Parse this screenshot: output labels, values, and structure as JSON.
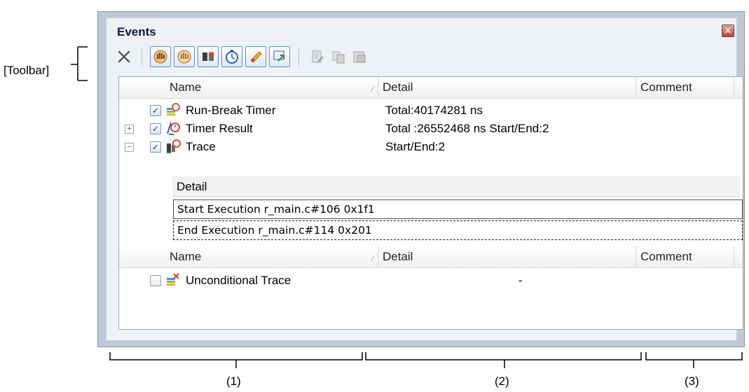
{
  "annotations": {
    "toolbar_label": "[Toolbar]",
    "col1": "(1)",
    "col2": "(2)",
    "col3": "(3)"
  },
  "window": {
    "title": "Events",
    "close_glyph": "✕"
  },
  "toolbar": {
    "buttons": [
      {
        "icon": "delete-icon"
      },
      {
        "icon": "hardware-break-icon"
      },
      {
        "icon": "software-break-icon"
      },
      {
        "icon": "trace-icon"
      },
      {
        "icon": "timer-icon"
      },
      {
        "icon": "point-trace-icon"
      },
      {
        "icon": "jump-source-icon"
      },
      {
        "icon": "edit-comment-icon"
      },
      {
        "icon": "copy-icon"
      },
      {
        "icon": "paste-icon"
      }
    ]
  },
  "table": {
    "header": {
      "name": "Name",
      "detail": "Detail",
      "comment": "Comment"
    },
    "rows": [
      {
        "name": "Run-Break Timer",
        "detail": "Total:40174281 ns",
        "checked": true,
        "expander": ""
      },
      {
        "name": "Timer Result",
        "detail": "Total :26552468 ns  Start/End:2",
        "checked": true,
        "expander": "+"
      },
      {
        "name": "Trace",
        "detail": "Start/End:2",
        "checked": true,
        "expander": "−"
      }
    ],
    "sub_table": {
      "header": "Detail",
      "rows": [
        "Start Execution r_main.c#106 0x1f1",
        "End Execution r_main.c#114 0x201"
      ]
    },
    "header2": {
      "name": "Name",
      "detail": "Detail",
      "comment": "Comment"
    },
    "rows2": [
      {
        "name": "Unconditional Trace",
        "detail": "-",
        "checked": false
      }
    ]
  },
  "colors": {
    "window_frame": "#bfc9d6",
    "panel_bg": "#eef2f7",
    "button_border": "#6c8fc2"
  }
}
